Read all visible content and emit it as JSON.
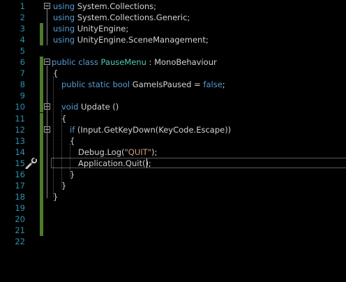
{
  "editor": {
    "lines": [
      {
        "num": "1",
        "tokens": [
          {
            "t": "using",
            "c": "kw"
          },
          {
            "t": " System.Collections;",
            "c": "plain"
          }
        ]
      },
      {
        "num": "2",
        "tokens": [
          {
            "t": "using",
            "c": "kw"
          },
          {
            "t": " System.Collections.Generic;",
            "c": "plain"
          }
        ]
      },
      {
        "num": "3",
        "tokens": [
          {
            "t": "using",
            "c": "kw"
          },
          {
            "t": " UnityEngine;",
            "c": "plain"
          }
        ]
      },
      {
        "num": "4",
        "tokens": [
          {
            "t": "using",
            "c": "kw"
          },
          {
            "t": " UnityEngine.SceneManagement;",
            "c": "plain"
          }
        ]
      },
      {
        "num": "5",
        "tokens": []
      },
      {
        "num": "6",
        "tokens": [
          {
            "t": "public",
            "c": "kw"
          },
          {
            "t": " ",
            "c": "plain"
          },
          {
            "t": "class",
            "c": "kw"
          },
          {
            "t": " ",
            "c": "plain"
          },
          {
            "t": "PauseMenu",
            "c": "type"
          },
          {
            "t": " : MonoBehaviour",
            "c": "plain"
          }
        ]
      },
      {
        "num": "7",
        "tokens": [
          {
            "t": "{",
            "c": "plain"
          }
        ]
      },
      {
        "num": "8",
        "tokens": [
          {
            "t": "public",
            "c": "kw"
          },
          {
            "t": " ",
            "c": "plain"
          },
          {
            "t": "static",
            "c": "kw"
          },
          {
            "t": " ",
            "c": "plain"
          },
          {
            "t": "bool",
            "c": "kw"
          },
          {
            "t": " GameIsPaused = ",
            "c": "plain"
          },
          {
            "t": "false",
            "c": "kw"
          },
          {
            "t": ";",
            "c": "plain"
          }
        ]
      },
      {
        "num": "9",
        "tokens": []
      },
      {
        "num": "10",
        "tokens": [
          {
            "t": "void",
            "c": "kw"
          },
          {
            "t": " Update ()",
            "c": "plain"
          }
        ]
      },
      {
        "num": "11",
        "tokens": [
          {
            "t": "{",
            "c": "plain"
          }
        ]
      },
      {
        "num": "12",
        "tokens": [
          {
            "t": "if",
            "c": "kw"
          },
          {
            "t": " (Input.GetKeyDown(KeyCode.Escape))",
            "c": "plain"
          }
        ]
      },
      {
        "num": "13",
        "tokens": [
          {
            "t": "{",
            "c": "plain"
          }
        ]
      },
      {
        "num": "14",
        "tokens": [
          {
            "t": "Debug.Log(",
            "c": "plain"
          },
          {
            "t": "\"QUIT\"",
            "c": "str"
          },
          {
            "t": ");",
            "c": "plain"
          }
        ]
      },
      {
        "num": "15",
        "tokens": [
          {
            "t": "Application.Quit();",
            "c": "plain"
          }
        ]
      },
      {
        "num": "16",
        "tokens": [
          {
            "t": "}",
            "c": "plain"
          }
        ]
      },
      {
        "num": "17",
        "tokens": [
          {
            "t": "}",
            "c": "plain"
          }
        ]
      },
      {
        "num": "18",
        "tokens": [
          {
            "t": "}",
            "c": "plain"
          }
        ]
      },
      {
        "num": "19",
        "tokens": []
      },
      {
        "num": "20",
        "tokens": []
      },
      {
        "num": "21",
        "tokens": []
      },
      {
        "num": "22",
        "tokens": []
      }
    ],
    "changed_lines": [
      3,
      4,
      6,
      7,
      8,
      9,
      10,
      11,
      12,
      13,
      14,
      15,
      16,
      17,
      18,
      19,
      20,
      21
    ],
    "fold_lines": [
      1,
      6,
      10,
      12
    ],
    "current_line": 15,
    "colors": {
      "background": "#000000",
      "line_number": "#2b91af",
      "keyword": "#569cd6",
      "type": "#4ec9b0",
      "string": "#d69d85",
      "text": "#d4d4d4",
      "change_bar": "#4e7a2e"
    },
    "margin_icon": "screwdriver-icon"
  }
}
